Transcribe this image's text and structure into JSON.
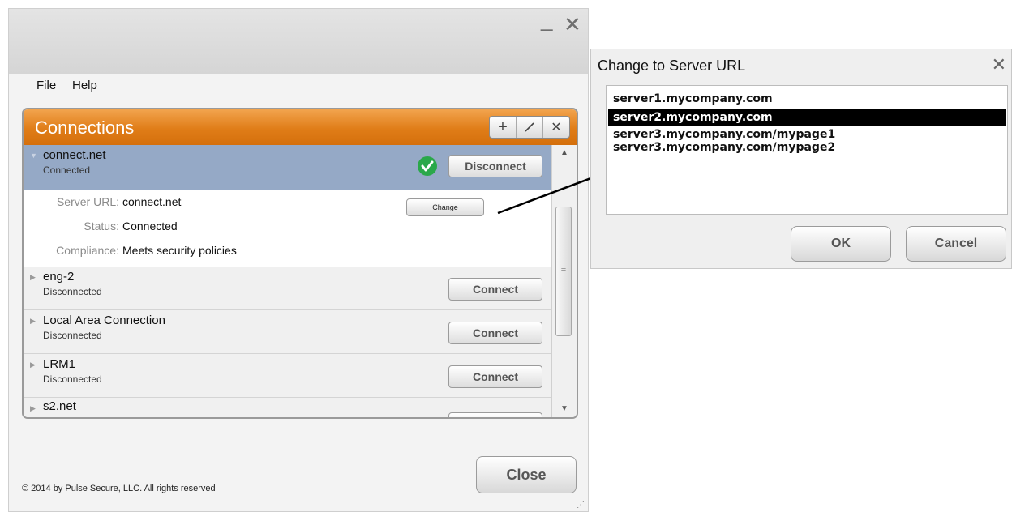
{
  "window": {
    "minimize_glyph": "_",
    "close_glyph": "✕"
  },
  "menu": {
    "items": [
      "File",
      "Help"
    ]
  },
  "connections": {
    "title": "Connections",
    "toolbar": {
      "add": "+",
      "edit": "✎",
      "delete": "✕"
    },
    "rows": [
      {
        "name": "connect.net",
        "status": "Connected",
        "button": "Disconnect",
        "expanded": true
      },
      {
        "name": "eng-2",
        "status": "Disconnected",
        "button": "Connect"
      },
      {
        "name": "Local Area Connection",
        "status": "Disconnected",
        "button": "Connect"
      },
      {
        "name": "LRM1",
        "status": "Disconnected",
        "button": "Connect"
      },
      {
        "name": "s2.net",
        "status": "",
        "button": ""
      }
    ],
    "details": {
      "server_url_label": "Server URL:",
      "server_url_value": "connect.net",
      "change_button": "Change",
      "status_label": "Status:",
      "status_value": "Connected",
      "compliance_label": "Compliance:",
      "compliance_value": "Meets security policies"
    }
  },
  "footer": {
    "copyright": "© 2014 by Pulse Secure, LLC. All rights reserved",
    "close_button": "Close"
  },
  "dialog": {
    "title": "Change to Server URL",
    "close_glyph": "✕",
    "urls": [
      "server1.mycompany.com",
      "server2.mycompany.com",
      "server3.mycompany.com/mypage1",
      "server3.mycompany.com/mypage2"
    ],
    "selected_index": 1,
    "ok_button": "OK",
    "cancel_button": "Cancel"
  },
  "icons": {
    "check": "check-circle-icon",
    "expand": "triangle-right-icon",
    "scroll": "scroll-arrow-icon"
  },
  "colors": {
    "header_orange": "#e07d18",
    "selected_row": "#95a9c6",
    "check_green": "#2aa84a"
  }
}
